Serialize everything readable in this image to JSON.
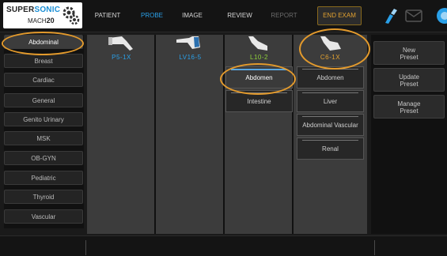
{
  "brand": {
    "line1_a": "SUPER",
    "line1_b": "SONIC",
    "line2_a": "MACH",
    "line2_b": "20"
  },
  "nav": {
    "patient": "PATIENT",
    "probe": "PROBE",
    "image": "IMAGE",
    "review": "REVIEW",
    "report": "REPORT",
    "end_exam": "END EXAM"
  },
  "applications": [
    "Abdominal",
    "Breast",
    "Cardiac",
    "General",
    "Genito Urinary",
    "MSK",
    "OB-GYN",
    "Pediatric",
    "Thyroid",
    "Vascular"
  ],
  "selected_application": "Abdominal",
  "probes": [
    {
      "name": "P5-1X",
      "presets": []
    },
    {
      "name": "LV16-5",
      "presets": []
    },
    {
      "name": "L10-2",
      "presets": [
        "Abdomen",
        "Intestine"
      ]
    },
    {
      "name": "C6-1X",
      "presets": [
        "Abdomen",
        "Liver",
        "Abdominal Vascular",
        "Renal"
      ]
    }
  ],
  "selected_probe": "C6-1X",
  "selected_preset": "Abdomen",
  "actions": {
    "new_preset": "New\nPreset",
    "update_preset": "Update\nPreset",
    "manage_preset": "Manage\nPreset"
  },
  "colors": {
    "accent_blue": "#2aa0e8",
    "accent_orange": "#e0a030",
    "highlight": "#e39a2c"
  }
}
